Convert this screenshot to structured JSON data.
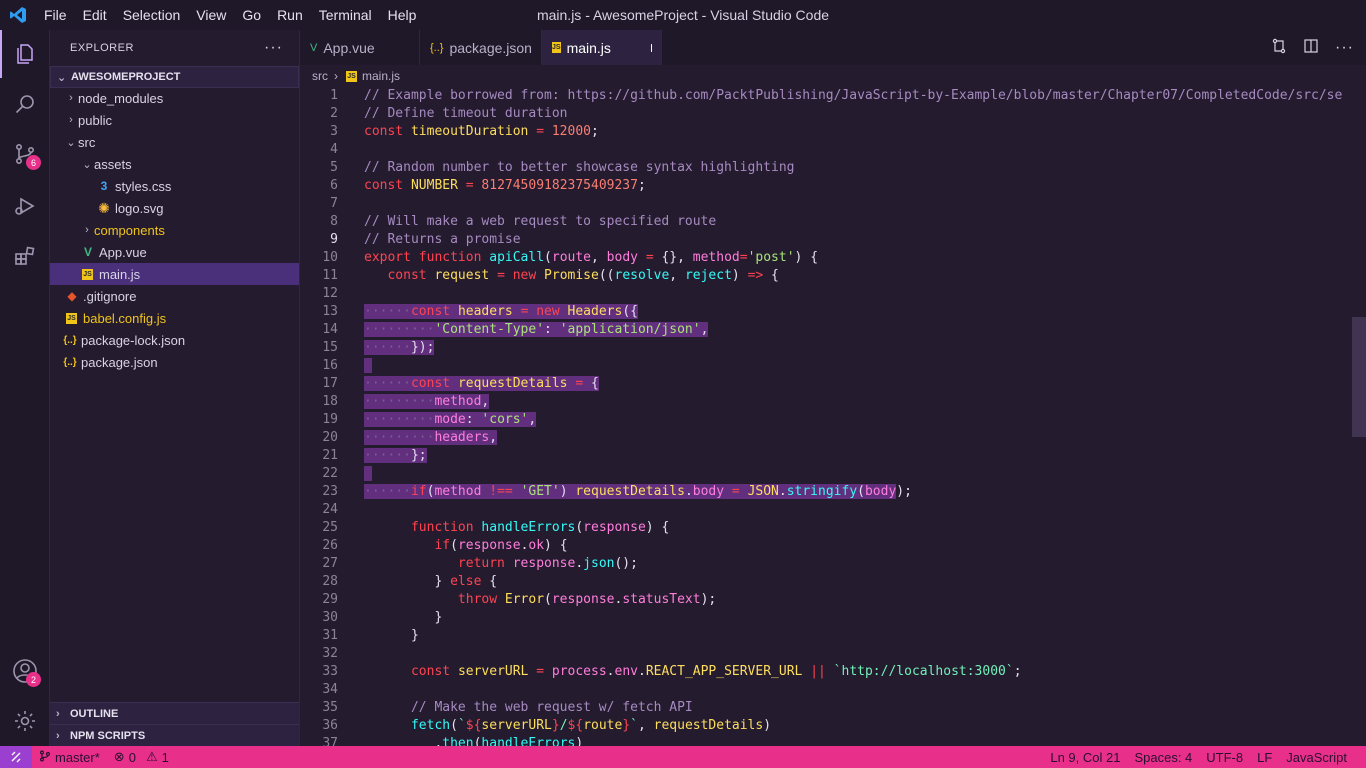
{
  "app": {
    "window_title": "main.js - AwesomeProject - Visual Studio Code",
    "menu": [
      "File",
      "Edit",
      "Selection",
      "View",
      "Go",
      "Run",
      "Terminal",
      "Help"
    ]
  },
  "activity_bar": {
    "items": [
      "explorer",
      "search",
      "source-control",
      "run-debug",
      "extensions"
    ],
    "source_control_badge": "6",
    "accounts_badge": "2"
  },
  "sidebar": {
    "title": "EXPLORER",
    "project": "AWESOMEPROJECT",
    "tree": [
      {
        "label": "node_modules",
        "type": "folder",
        "expanded": false
      },
      {
        "label": "public",
        "type": "folder",
        "expanded": false
      },
      {
        "label": "src",
        "type": "folder",
        "expanded": true
      },
      {
        "label": "assets",
        "type": "folder",
        "expanded": true
      },
      {
        "label": "styles.css",
        "type": "css"
      },
      {
        "label": "logo.svg",
        "type": "svg"
      },
      {
        "label": "components",
        "type": "folder",
        "expanded": false
      },
      {
        "label": "App.vue",
        "type": "vue"
      },
      {
        "label": "main.js",
        "type": "js",
        "selected": true
      },
      {
        "label": ".gitignore",
        "type": "git"
      },
      {
        "label": "babel.config.js",
        "type": "js"
      },
      {
        "label": "package-lock.json",
        "type": "json"
      },
      {
        "label": "package.json",
        "type": "json"
      }
    ],
    "outline": "OUTLINE",
    "npm_scripts": "NPM SCRIPTS"
  },
  "tabs": [
    {
      "label": "App.vue",
      "icon": "vue"
    },
    {
      "label": "package.json",
      "icon": "json"
    },
    {
      "label": "main.js",
      "icon": "js",
      "active": true,
      "modified": true
    }
  ],
  "breadcrumb": [
    "src",
    "main.js"
  ],
  "editor": {
    "current_line": 9,
    "line_numbers": [
      "1",
      "2",
      "3",
      "4",
      "5",
      "6",
      "7",
      "8",
      "9",
      "10",
      "11",
      "12",
      "13",
      "14",
      "15",
      "16",
      "17",
      "18",
      "19",
      "20",
      "21",
      "22",
      "23",
      "24",
      "25",
      "26",
      "27",
      "28",
      "29",
      "30",
      "31",
      "32",
      "33",
      "34",
      "35",
      "36",
      "37"
    ]
  },
  "statusbar": {
    "branch": "master*",
    "errors": "0",
    "warnings": "1",
    "position": "Ln 9, Col 21",
    "spaces": "Spaces: 4",
    "encoding": "UTF-8",
    "eol": "LF",
    "language": "JavaScript"
  },
  "colors": {
    "accent": "#e8308a",
    "selection": "#4a2f7a",
    "background": "#241b2f"
  }
}
